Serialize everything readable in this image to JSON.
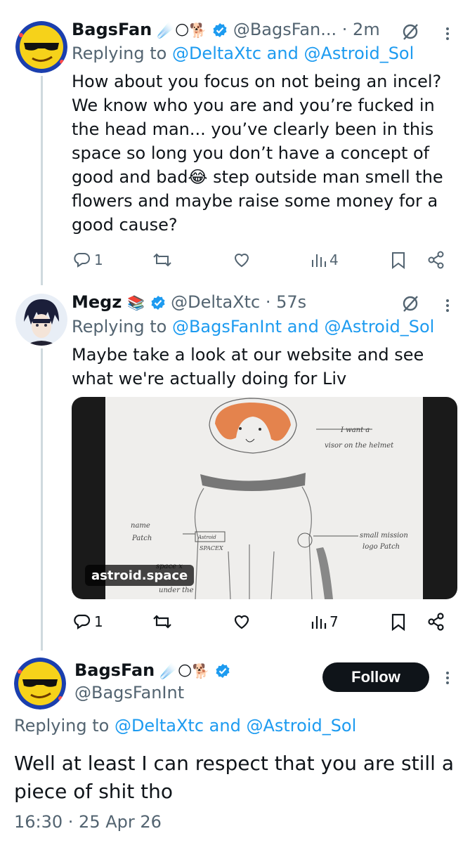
{
  "tweets": [
    {
      "name": "BagsFan",
      "emoji": "☄️🌕🐕",
      "handle": "@BagsFan...",
      "time": "2m",
      "reply_prefix": "Replying to",
      "reply_targets": "@DeltaXtc and @Astroid_Sol",
      "body": "How about you focus on not being an incel? We know who you are and you’re fucked in the head man... you’ve clearly been in this space so long you don’t have a concept of good and bad😂 step outside man smell the flowers and maybe raise some money for a good cause?",
      "replies": "1",
      "views": "4"
    },
    {
      "name": "Megz",
      "emoji": "📚",
      "handle": "@DeltaXtc",
      "time": "57s",
      "reply_prefix": "Replying to",
      "reply_targets": "@BagsFanInt and @Astroid_Sol",
      "body": "Maybe take a look at our website and see what we're actually doing for Liv",
      "link_domain": "astroid.space",
      "replies": "1",
      "views": "7",
      "sketch_labels": {
        "visor_1": "I want a",
        "visor_2": "visor on the helmet",
        "name_1": "name",
        "name_2": "Patch",
        "badge_1": "Astroid",
        "badge_2": "SPACEX",
        "mission_1": "small mission",
        "mission_2": "logo Patch",
        "bottom_1": "space x",
        "bottom_2": "under the"
      }
    }
  ],
  "focused": {
    "name": "BagsFan",
    "emoji": "☄️🌕🐕",
    "handle": "@BagsFanInt",
    "follow_label": "Follow",
    "reply_prefix": "Replying to",
    "reply_targets": "@DeltaXtc and @Astroid_Sol",
    "body": "Well at least I can respect that you are still a piece of shit tho",
    "timestamp": "16:30 · 25 Apr 26"
  },
  "colors": {
    "link": "#1d9bf0",
    "text": "#0f1419",
    "muted": "#536471",
    "verified": "#1d9bf0"
  }
}
